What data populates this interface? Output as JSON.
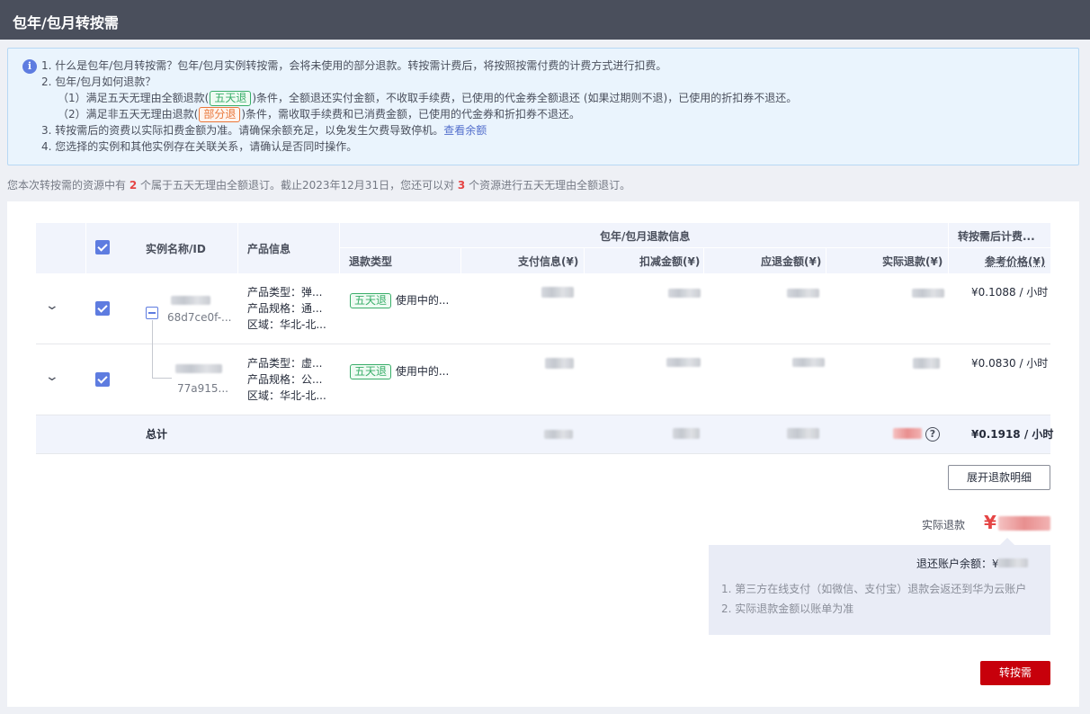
{
  "header": {
    "title": "包年/包月转按需"
  },
  "notice": {
    "line1": "1. 什么是包年/包月转按需？包年/包月实例转按需，会将未使用的部分退款。转按需计费后，将按照按需付费的计费方式进行扣费。",
    "line2": "2. 包年/包月如何退款？",
    "line3_pre": "（1）满足五天无理由全额退款(",
    "line3_tag": "五天退",
    "line3_post": ")条件，全额退还实付金额，不收取手续费，已使用的代金券全额退还 (如果过期则不退)，已使用的折扣券不退还。",
    "line4_pre": "（2）满足非五天无理由退款(",
    "line4_tag": "部分退",
    "line4_post": ")条件，需收取手续费和已消费金额，已使用的代金券和折扣券不退还。",
    "line5_pre": "3. 转按需后的资费以实际扣费金额为准。请确保余额充足，以免发生欠费导致停机。",
    "line5_link": "查看余额",
    "line6": "4. 您选择的实例和其他实例存在关联关系，请确认是否同时操作。"
  },
  "summary": {
    "p1": "您本次转按需的资源中有 ",
    "n1": "2",
    "p2": " 个属于五天无理由全额退订。截止2023年12月31日，您还可以对 ",
    "n2": "3",
    "p3": " 个资源进行五天无理由全额退订。"
  },
  "table": {
    "headers": {
      "name": "实例名称/ID",
      "product": "产品信息",
      "group_refund": "包年/包月退款信息",
      "group_after": "转按需后计费...",
      "refund_type": "退款类型",
      "paid": "支付信息(¥)",
      "deduct": "扣减金额(¥)",
      "due": "应退金额(¥)",
      "actual": "实际退款(¥)",
      "ref_price": "参考价格(¥)"
    },
    "rows": [
      {
        "id": "68d7ce0f-...",
        "type_line": "产品类型：弹...",
        "spec_line": "产品规格：通...",
        "region_line": "区域：华北-北...",
        "refund_tag": "五天退",
        "refund_text": "使用中的...",
        "ref_price": "¥0.1088 / 小时"
      },
      {
        "id": "77a915...",
        "type_line": "产品类型：虚...",
        "spec_line": "产品规格：公...",
        "region_line": "区域：华北-北...",
        "refund_tag": "五天退",
        "refund_text": "使用中的...",
        "ref_price": "¥0.0830 / 小时"
      }
    ],
    "total": {
      "label": "总计",
      "ref_price": "¥0.1918 / 小时"
    }
  },
  "actions": {
    "expand_detail": "展开退款明细",
    "actual_refund_label": "实际退款",
    "yen": "¥",
    "balance_title": "退还账户余额：¥",
    "note1": "1. 第三方在线支付（如微信、支付宝）退款会返还到华为云账户",
    "note2": "2. 实际退款金额以账单为准",
    "submit": "转按需"
  }
}
